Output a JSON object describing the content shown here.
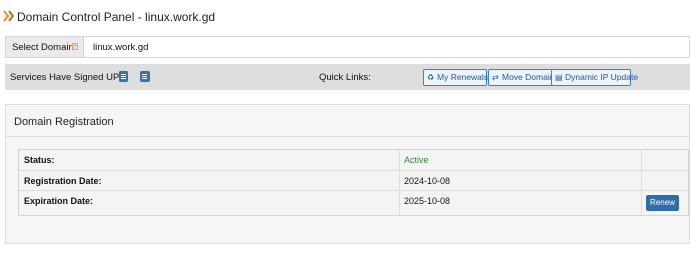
{
  "header": {
    "title": "Domain Control Panel - linux.work.gd",
    "icon": "double-chevron-right-icon",
    "accent_color": "#f08a24"
  },
  "domain_selector": {
    "label": "Select Domain:",
    "value": "linux.work.gd"
  },
  "services_bar": {
    "services_label": "Services Have Signed UP:",
    "service_icons": [
      "document-icon",
      "mail-icon"
    ],
    "quick_links_label": "Quick Links:",
    "quick_links": [
      {
        "label": "My Renewals",
        "icon": "recycle-icon"
      },
      {
        "label": "Move Domain",
        "icon": "swap-arrows-icon"
      },
      {
        "label": "Dynamic IP Update",
        "icon": "document-icon"
      }
    ]
  },
  "registration": {
    "title": "Domain Registration",
    "rows": [
      {
        "label": "Status:",
        "value": "Active"
      },
      {
        "label": "Registration Date:",
        "value": "2024-10-08"
      },
      {
        "label": "Expiration Date:",
        "value": "2025-10-08"
      }
    ],
    "renew_label": "Renew",
    "status_color": "#2e8b2e",
    "button_color": "#2e6ea8"
  }
}
